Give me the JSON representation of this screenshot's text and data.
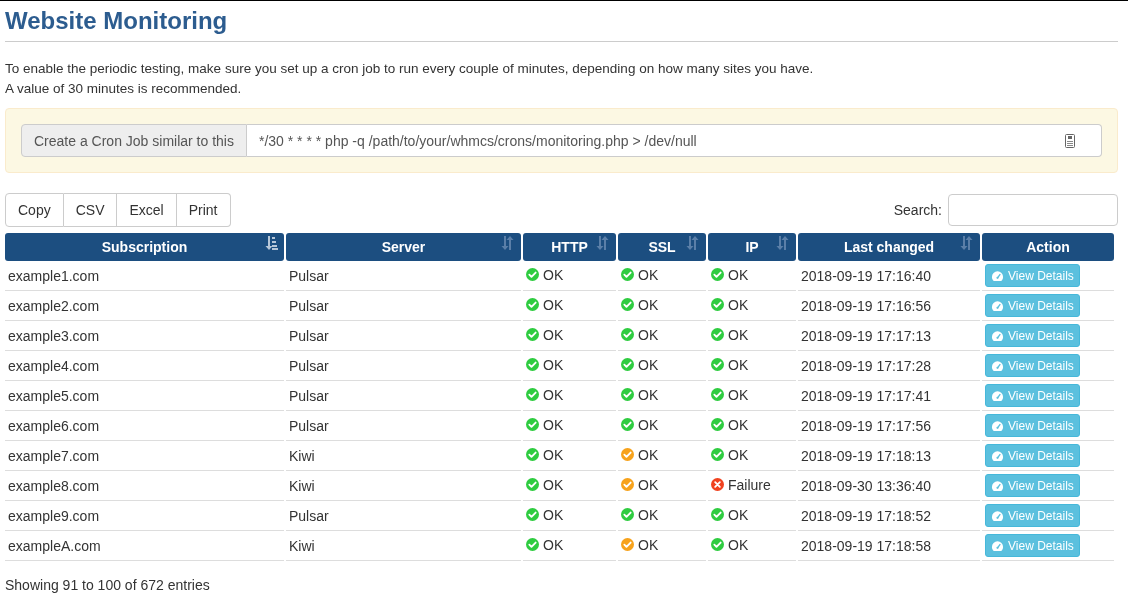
{
  "title": "Website Monitoring",
  "intro": [
    "To enable the periodic testing, make sure you set up a cron job to run every couple of minutes, depending on how many sites you have.",
    "A value of 30 minutes is recommended."
  ],
  "cron": {
    "label": "Create a Cron Job similar to this",
    "value": "*/30 * * * * php -q /path/to/your/whmcs/crons/monitoring.php > /dev/null"
  },
  "export_buttons": [
    "Copy",
    "CSV",
    "Excel",
    "Print"
  ],
  "search": {
    "label": "Search:"
  },
  "table": {
    "columns": [
      {
        "label": "Subscription",
        "kind": "sorted"
      },
      {
        "label": "Server",
        "kind": "sortable"
      },
      {
        "label": "HTTP",
        "kind": "sortable"
      },
      {
        "label": "SSL",
        "kind": "sortable"
      },
      {
        "label": "IP",
        "kind": "sortable"
      },
      {
        "label": "Last changed",
        "kind": "sortable"
      },
      {
        "label": "Action",
        "kind": "plain"
      }
    ],
    "rows": [
      {
        "subscription": "example1.com",
        "server": "Pulsar",
        "http": {
          "kind": "ok",
          "text": "OK"
        },
        "ssl": {
          "kind": "ok",
          "text": "OK"
        },
        "ip": {
          "kind": "ok",
          "text": "OK"
        },
        "last_changed": "2018-09-19 17:16:40",
        "action": "View Details"
      },
      {
        "subscription": "example2.com",
        "server": "Pulsar",
        "http": {
          "kind": "ok",
          "text": "OK"
        },
        "ssl": {
          "kind": "ok",
          "text": "OK"
        },
        "ip": {
          "kind": "ok",
          "text": "OK"
        },
        "last_changed": "2018-09-19 17:16:56",
        "action": "View Details"
      },
      {
        "subscription": "example3.com",
        "server": "Pulsar",
        "http": {
          "kind": "ok",
          "text": "OK"
        },
        "ssl": {
          "kind": "ok",
          "text": "OK"
        },
        "ip": {
          "kind": "ok",
          "text": "OK"
        },
        "last_changed": "2018-09-19 17:17:13",
        "action": "View Details"
      },
      {
        "subscription": "example4.com",
        "server": "Pulsar",
        "http": {
          "kind": "ok",
          "text": "OK"
        },
        "ssl": {
          "kind": "ok",
          "text": "OK"
        },
        "ip": {
          "kind": "ok",
          "text": "OK"
        },
        "last_changed": "2018-09-19 17:17:28",
        "action": "View Details"
      },
      {
        "subscription": "example5.com",
        "server": "Pulsar",
        "http": {
          "kind": "ok",
          "text": "OK"
        },
        "ssl": {
          "kind": "ok",
          "text": "OK"
        },
        "ip": {
          "kind": "ok",
          "text": "OK"
        },
        "last_changed": "2018-09-19 17:17:41",
        "action": "View Details"
      },
      {
        "subscription": "example6.com",
        "server": "Pulsar",
        "http": {
          "kind": "ok",
          "text": "OK"
        },
        "ssl": {
          "kind": "ok",
          "text": "OK"
        },
        "ip": {
          "kind": "ok",
          "text": "OK"
        },
        "last_changed": "2018-09-19 17:17:56",
        "action": "View Details"
      },
      {
        "subscription": "example7.com",
        "server": "Kiwi",
        "http": {
          "kind": "ok",
          "text": "OK"
        },
        "ssl": {
          "kind": "warning",
          "text": "OK"
        },
        "ip": {
          "kind": "ok",
          "text": "OK"
        },
        "last_changed": "2018-09-19 17:18:13",
        "action": "View Details"
      },
      {
        "subscription": "example8.com",
        "server": "Kiwi",
        "http": {
          "kind": "ok",
          "text": "OK"
        },
        "ssl": {
          "kind": "warning",
          "text": "OK"
        },
        "ip": {
          "kind": "failure",
          "text": "Failure"
        },
        "last_changed": "2018-09-30 13:36:40",
        "action": "View Details"
      },
      {
        "subscription": "example9.com",
        "server": "Pulsar",
        "http": {
          "kind": "ok",
          "text": "OK"
        },
        "ssl": {
          "kind": "ok",
          "text": "OK"
        },
        "ip": {
          "kind": "ok",
          "text": "OK"
        },
        "last_changed": "2018-09-19 17:18:52",
        "action": "View Details"
      },
      {
        "subscription": "exampleA.com",
        "server": "Kiwi",
        "http": {
          "kind": "ok",
          "text": "OK"
        },
        "ssl": {
          "kind": "warning",
          "text": "OK"
        },
        "ip": {
          "kind": "ok",
          "text": "OK"
        },
        "last_changed": "2018-09-19 17:18:58",
        "action": "View Details"
      }
    ]
  },
  "footer": "Showing 91 to 100 of 672 entries"
}
